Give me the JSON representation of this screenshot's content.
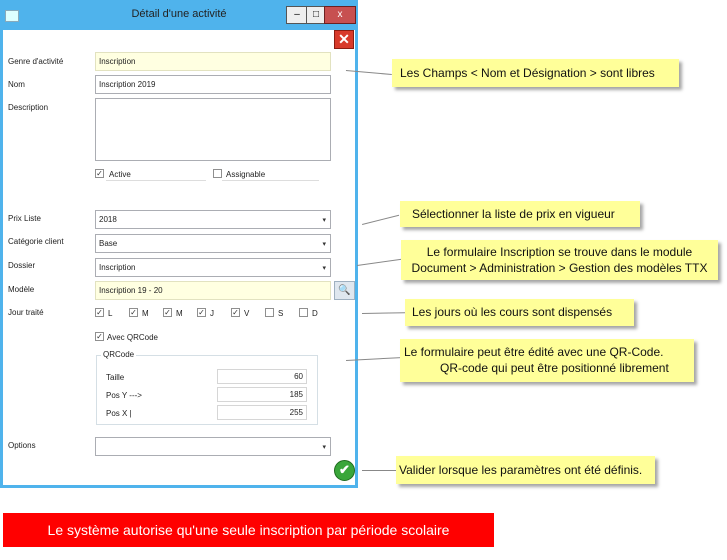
{
  "window": {
    "title": "Détail d'une activité",
    "minimize": "–",
    "maximize": "□",
    "close": "x"
  },
  "form": {
    "genre_label": "Genre d'activité",
    "genre_value": "Inscription",
    "nom_label": "Nom",
    "nom_value": "Inscription 2019",
    "description_label": "Description",
    "description_value": "",
    "active_label": "Active",
    "active_checked": true,
    "assignable_label": "Assignable",
    "assignable_checked": false,
    "prix_label": "Prix Liste",
    "prix_value": "2018",
    "categorie_label": "Catégorie client",
    "categorie_value": "Base",
    "dossier_label": "Dossier",
    "dossier_value": "Inscription",
    "modele_label": "Modèle",
    "modele_value": "Inscription 19 - 20",
    "jour_label": "Jour traité",
    "days": [
      {
        "label": "L",
        "checked": true
      },
      {
        "label": "M",
        "checked": true
      },
      {
        "label": "M",
        "checked": true
      },
      {
        "label": "J",
        "checked": true
      },
      {
        "label": "V",
        "checked": true
      },
      {
        "label": "S",
        "checked": false
      },
      {
        "label": "D",
        "checked": false
      }
    ],
    "qrcode_check_label": "Avec QRCode",
    "qrcode_group_label": "QRCode",
    "taille_label": "Taille",
    "taille_value": "60",
    "posy_label": "Pos Y --->",
    "posy_value": "185",
    "posx_label": "Pos X |",
    "posx_value": "255",
    "options_label": "Options",
    "options_value": ""
  },
  "callouts": {
    "c1": "Les Champs < Nom et Désignation > sont libres",
    "c2": "Sélectionner la liste de prix en vigueur",
    "c3_line1": "Le formulaire Inscription se trouve dans le module",
    "c3_line2": "Document > Administration > Gestion des modèles TTX",
    "c4": "Les jours où les cours sont dispensés",
    "c5_line1": "Le formulaire peut être édité avec une QR-Code.",
    "c5_line2": "QR-code qui peut être positionné librement",
    "c6": "Valider lorsque les paramètres ont été définis."
  },
  "banner": "Le système autorise qu'une seule inscription  par période scolaire",
  "colors": {
    "window_border": "#4fb3ec",
    "callout": "#ffff99",
    "banner": "#ff0000"
  }
}
